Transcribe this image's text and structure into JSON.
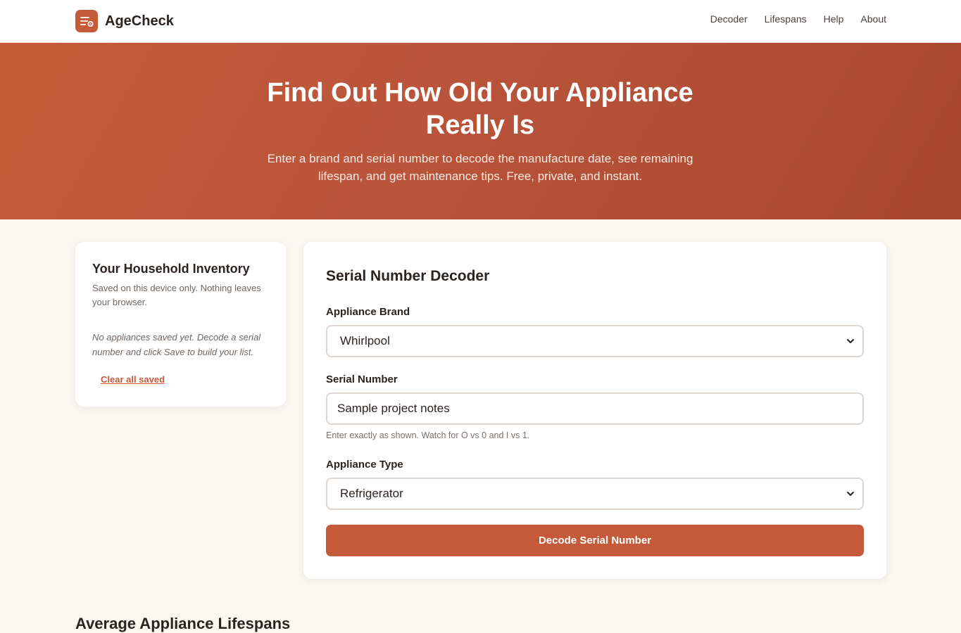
{
  "header": {
    "brand_name": "AgeCheck",
    "logo_icon": "list-gear-icon",
    "nav": [
      "Decoder",
      "Lifespans",
      "Help",
      "About"
    ]
  },
  "hero": {
    "title": "Find Out How Old Your Appliance Really Is",
    "subtitle": "Enter a brand and serial number to decode the manufacture date, see remaining lifespan, and get maintenance tips. Free, private, and instant."
  },
  "inventory": {
    "title": "Your Household Inventory",
    "subtitle": "Saved on this device only. Nothing leaves your browser.",
    "empty_message": "No appliances saved yet. Decode a serial number and click Save to build your list.",
    "clear_label": "Clear all saved"
  },
  "decoder": {
    "title": "Serial Number Decoder",
    "brand_label": "Appliance Brand",
    "brand_value": "Whirlpool",
    "serial_label": "Serial Number",
    "serial_value": "Sample project notes",
    "serial_hint": "Enter exactly as shown. Watch for O vs 0 and I vs 1.",
    "type_label": "Appliance Type",
    "type_value": "Refrigerator",
    "decode_label": "Decode Serial Number"
  },
  "lifespans": {
    "title": "Average Appliance Lifespans"
  },
  "colors": {
    "accent": "#c55a3a",
    "hero_start": "#c75b39",
    "hero_end": "#a9472d",
    "page_bg": "#fbf7f3"
  }
}
